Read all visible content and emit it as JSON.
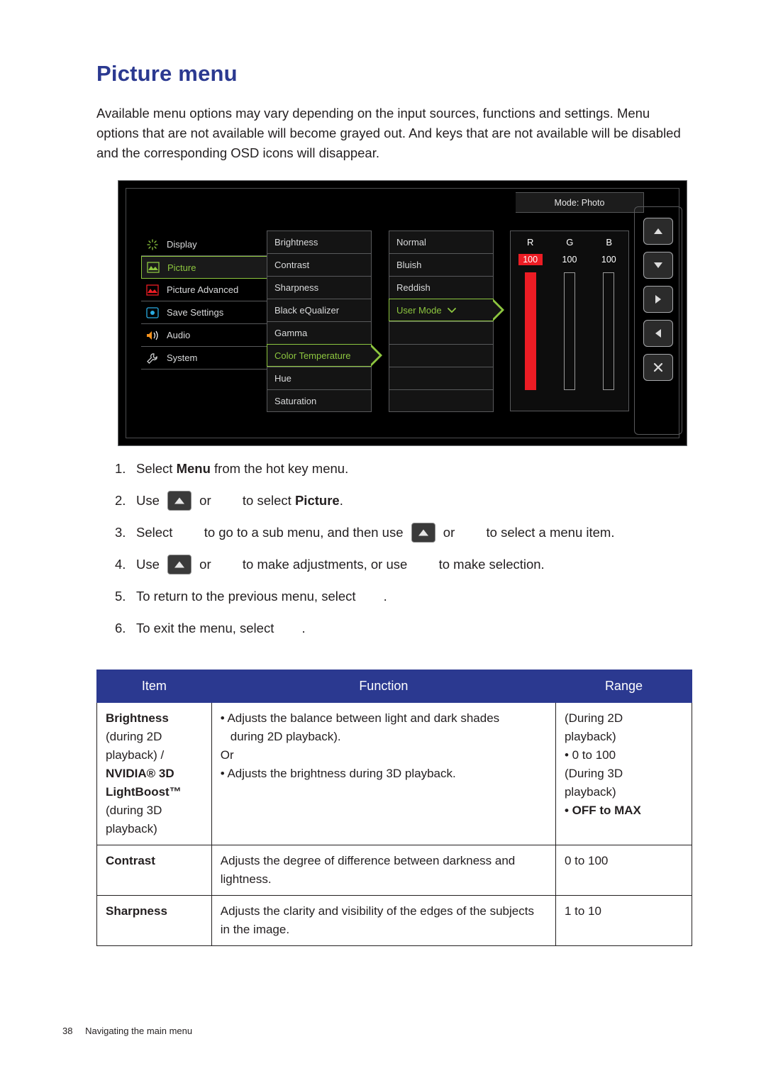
{
  "heading": "Picture menu",
  "intro": "Available menu options may vary depending on the input sources, functions and settings. Menu options that are not available will become grayed out. And keys that are not available will be disabled and the corresponding OSD icons will disappear.",
  "osd": {
    "mode_label": "Mode: Photo",
    "main_menu": [
      {
        "label": "Display",
        "icon": "display-icon",
        "selected": false
      },
      {
        "label": "Picture",
        "icon": "picture-icon",
        "selected": true
      },
      {
        "label": "Picture Advanced",
        "icon": "picture-advanced-icon",
        "selected": false
      },
      {
        "label": "Save Settings",
        "icon": "save-settings-icon",
        "selected": false
      },
      {
        "label": "Audio",
        "icon": "audio-icon",
        "selected": false
      },
      {
        "label": "System",
        "icon": "system-icon",
        "selected": false
      }
    ],
    "sub_menu": [
      {
        "label": "Brightness",
        "highlighted": false
      },
      {
        "label": "Contrast",
        "highlighted": false
      },
      {
        "label": "Sharpness",
        "highlighted": false
      },
      {
        "label": "Black eQualizer",
        "highlighted": false
      },
      {
        "label": "Gamma",
        "highlighted": false
      },
      {
        "label": "Color Temperature",
        "highlighted": true
      },
      {
        "label": "Hue",
        "highlighted": false
      },
      {
        "label": "Saturation",
        "highlighted": false
      }
    ],
    "options": [
      {
        "label": "Normal",
        "highlighted": false
      },
      {
        "label": "Bluish",
        "highlighted": false
      },
      {
        "label": "Reddish",
        "highlighted": false
      },
      {
        "label": "User Mode",
        "highlighted": true
      },
      {
        "label": "",
        "highlighted": false
      },
      {
        "label": "",
        "highlighted": false
      },
      {
        "label": "",
        "highlighted": false
      },
      {
        "label": "",
        "highlighted": false
      }
    ],
    "rgb": {
      "labels": [
        "R",
        "G",
        "B"
      ],
      "values": [
        "100",
        "100",
        "100"
      ],
      "selected_index": 0
    },
    "keys": [
      {
        "name": "up-key",
        "glyph": "up"
      },
      {
        "name": "down-key",
        "glyph": "down"
      },
      {
        "name": "right-key",
        "glyph": "right"
      },
      {
        "name": "left-key",
        "glyph": "left"
      },
      {
        "name": "exit-key",
        "glyph": "x"
      }
    ]
  },
  "steps": [
    {
      "num": "1.",
      "pre": "Select ",
      "bold1": "Menu",
      "mid": " from the hot key menu.",
      "bold2": "",
      "post": "",
      "keys": []
    },
    {
      "num": "2.",
      "pre": "Use ",
      "mid": " or ",
      "bold1": "",
      "post": " to select ",
      "bold2": "Picture",
      "tail": "."
    },
    {
      "num": "3.",
      "pre": "Select ",
      "mid": " to go to a sub menu, and then use ",
      "post": " or ",
      "tail": " to select a menu item."
    },
    {
      "num": "4.",
      "pre": "Use ",
      "mid": " or ",
      "post": " to make adjustments, or use ",
      "tail": " to make selection."
    },
    {
      "num": "5.",
      "pre": "To return to the previous menu, select ",
      "tail": "."
    },
    {
      "num": "6.",
      "pre": "To exit the menu, select ",
      "tail": "."
    }
  ],
  "table": {
    "headers": [
      "Item",
      "Function",
      "Range"
    ],
    "rows": [
      {
        "item_bold_1": "Brightness",
        "item_light_1": "(during 2D",
        "item_light_2": "playback) /",
        "item_bold_2": "NVIDIA® 3D",
        "item_bold_3": "LightBoost™",
        "item_light_3": "(during 3D",
        "item_light_4": "playback)",
        "func_1": "• Adjusts the balance between light and dark shades",
        "func_2": "during 2D playback).",
        "func_3": "Or",
        "func_4": "• Adjusts the brightness during 3D playback.",
        "range_1": "(During 2D",
        "range_2": "playback)",
        "range_3": "• 0 to 100",
        "range_4": "(During 3D",
        "range_5": "playback)",
        "range_6": "• OFF to MAX"
      },
      {
        "item_bold_1": "Contrast",
        "func_1": "Adjusts the degree of difference between darkness and",
        "func_2": "lightness.",
        "range_1": "0 to 100"
      },
      {
        "item_bold_1": "Sharpness",
        "func_1": "Adjusts the clarity and visibility of the edges of the subjects",
        "func_2": "in the image.",
        "range_1": "1 to 10"
      }
    ]
  },
  "footer": {
    "page": "38",
    "text": "Navigating the main menu"
  }
}
